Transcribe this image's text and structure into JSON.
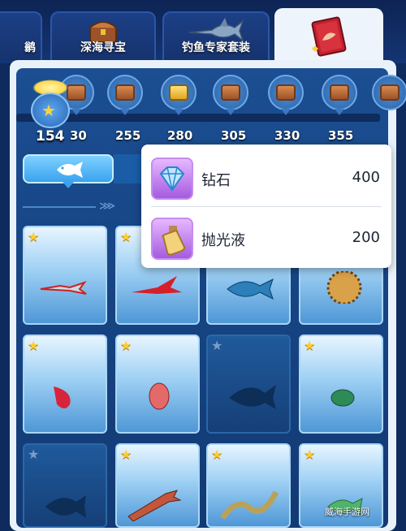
{
  "tabs": [
    {
      "label": "鹟",
      "icon": "partial-tab-icon",
      "active": false
    },
    {
      "label": "深海寻宝",
      "icon": "treasure-chest-icon",
      "active": false
    },
    {
      "label": "钓鱼专家套装",
      "icon": "swordfish-icon",
      "active": false
    },
    {
      "label": "",
      "icon": "red-book-icon",
      "active": true
    }
  ],
  "progress": {
    "current": "154",
    "milestones": [
      "30",
      "255",
      "280",
      "305",
      "330",
      "355"
    ]
  },
  "popup": {
    "items": [
      {
        "name": "钻石",
        "value": "400",
        "icon": "diamond-icon"
      },
      {
        "name": "抛光液",
        "value": "200",
        "icon": "polish-bottle-icon"
      }
    ]
  },
  "filter": {
    "icon": "fish-icon"
  },
  "cards": [
    {
      "fish": "red-dart-fish",
      "starred": true
    },
    {
      "fish": "red-flying-fish",
      "starred": true
    },
    {
      "fish": "blue-tropical-fish",
      "starred": true
    },
    {
      "fish": "pufferfish",
      "starred": true
    },
    {
      "fish": "red-shrimp",
      "starred": true
    },
    {
      "fish": "squid",
      "starred": true
    },
    {
      "fish": "locked-tuna",
      "starred": false
    },
    {
      "fish": "sea-turtle",
      "starred": true
    },
    {
      "fish": "locked-fish",
      "starred": false
    },
    {
      "fish": "salmon",
      "starred": true
    },
    {
      "fish": "eel",
      "starred": true
    },
    {
      "fish": "parrot-fish",
      "starred": true
    }
  ],
  "watermark": "威海手游网",
  "colors": {
    "accent": "#3aa3ee",
    "star": "#ffcc2e",
    "panel": "#e9f1fa"
  }
}
